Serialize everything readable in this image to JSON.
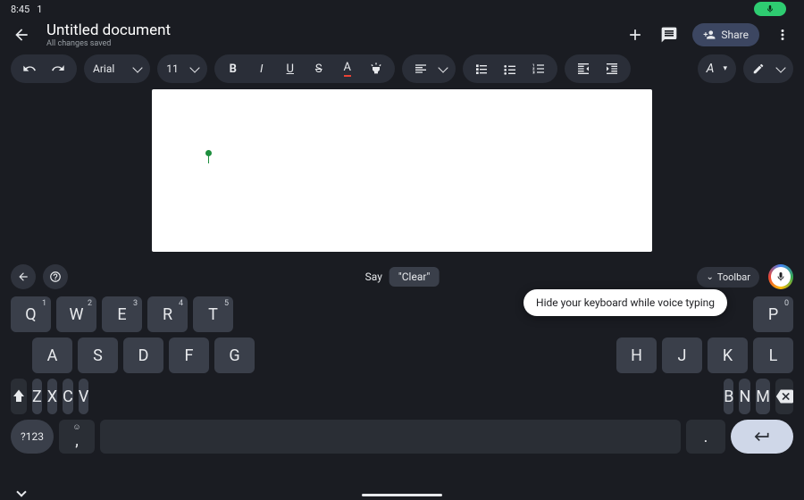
{
  "status": {
    "time": "8:45",
    "indicator": "1"
  },
  "header": {
    "title": "Untitled document",
    "saved": "All changes saved",
    "share": "Share"
  },
  "toolbar": {
    "font": "Arial",
    "size": "11",
    "format_text_label": "A"
  },
  "suggestion": {
    "prefix": "Say",
    "chip": "\"Clear\"",
    "toolbar_pill": "Toolbar"
  },
  "tooltip": "Hide your keyboard while voice typing",
  "keys": {
    "row1": [
      {
        "l": "Q",
        "s": "1"
      },
      {
        "l": "W",
        "s": "2"
      },
      {
        "l": "E",
        "s": "3"
      },
      {
        "l": "R",
        "s": "4"
      },
      {
        "l": "T",
        "s": "5"
      }
    ],
    "row1r": [
      {
        "l": "P",
        "s": "0"
      }
    ],
    "row2": [
      {
        "l": "A"
      },
      {
        "l": "S"
      },
      {
        "l": "D"
      },
      {
        "l": "F"
      },
      {
        "l": "G"
      }
    ],
    "row2r": [
      {
        "l": "H"
      },
      {
        "l": "J"
      },
      {
        "l": "K"
      },
      {
        "l": "L"
      }
    ],
    "row3": [
      {
        "l": "Z"
      },
      {
        "l": "X"
      },
      {
        "l": "C"
      },
      {
        "l": "V"
      }
    ],
    "row3r": [
      {
        "l": "B"
      },
      {
        "l": "N"
      },
      {
        "l": "M"
      }
    ],
    "sym": "?123",
    "comma_super": "☺",
    "comma": ",",
    "period": "."
  }
}
